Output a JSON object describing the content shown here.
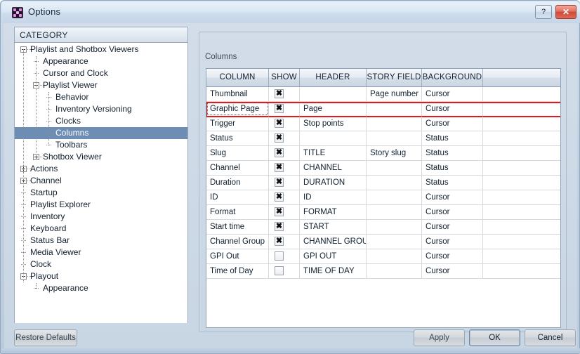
{
  "window": {
    "title": "Options",
    "app_icon": "options-app-icon",
    "help_button": "?",
    "close_button": "✕"
  },
  "category_panel": {
    "header": "CATEGORY",
    "items": [
      {
        "label": "Playlist and Shotbox Viewers",
        "depth": 0,
        "toggle": "minus",
        "selected": false
      },
      {
        "label": "Appearance",
        "depth": 1,
        "toggle": "none",
        "selected": false
      },
      {
        "label": "Cursor and Clock",
        "depth": 1,
        "toggle": "none",
        "selected": false
      },
      {
        "label": "Playlist Viewer",
        "depth": 1,
        "toggle": "minus",
        "selected": false
      },
      {
        "label": "Behavior",
        "depth": 2,
        "toggle": "none",
        "selected": false
      },
      {
        "label": "Inventory Versioning",
        "depth": 2,
        "toggle": "none",
        "selected": false
      },
      {
        "label": "Clocks",
        "depth": 2,
        "toggle": "none",
        "selected": false
      },
      {
        "label": "Columns",
        "depth": 2,
        "toggle": "none",
        "selected": true
      },
      {
        "label": "Toolbars",
        "depth": 2,
        "toggle": "none",
        "selected": false
      },
      {
        "label": "Shotbox Viewer",
        "depth": 1,
        "toggle": "plus",
        "selected": false
      },
      {
        "label": "Actions",
        "depth": 0,
        "toggle": "plus",
        "selected": false
      },
      {
        "label": "Channel",
        "depth": 0,
        "toggle": "plus",
        "selected": false
      },
      {
        "label": "Startup",
        "depth": 0,
        "toggle": "none",
        "selected": false
      },
      {
        "label": "Playlist Explorer",
        "depth": 0,
        "toggle": "none",
        "selected": false
      },
      {
        "label": "Inventory",
        "depth": 0,
        "toggle": "none",
        "selected": false
      },
      {
        "label": "Keyboard",
        "depth": 0,
        "toggle": "none",
        "selected": false
      },
      {
        "label": "Status Bar",
        "depth": 0,
        "toggle": "none",
        "selected": false
      },
      {
        "label": "Media Viewer",
        "depth": 0,
        "toggle": "none",
        "selected": false
      },
      {
        "label": "Clock",
        "depth": 0,
        "toggle": "none",
        "selected": false
      },
      {
        "label": "Playout",
        "depth": 0,
        "toggle": "minus",
        "selected": false
      },
      {
        "label": "Appearance",
        "depth": 1,
        "toggle": "none",
        "selected": false
      }
    ]
  },
  "groupbox": {
    "label": "Columns"
  },
  "grid": {
    "columns": [
      "COLUMN",
      "SHOW",
      "HEADER",
      "STORY FIELD",
      "BACKGROUND",
      ""
    ],
    "rows": [
      {
        "column": "Thumbnail",
        "show": true,
        "header": "",
        "story_field": "Page number",
        "background": "Cursor",
        "highlighted": false,
        "focused": false
      },
      {
        "column": "Graphic Page",
        "show": true,
        "header": "Page",
        "story_field": "",
        "background": "Cursor",
        "highlighted": true,
        "focused": true
      },
      {
        "column": "Trigger",
        "show": true,
        "header": "Stop points",
        "story_field": "",
        "background": "Cursor",
        "highlighted": false,
        "focused": false
      },
      {
        "column": "Status",
        "show": true,
        "header": "",
        "story_field": "",
        "background": "Status",
        "highlighted": false,
        "focused": false
      },
      {
        "column": "Slug",
        "show": true,
        "header": "TITLE",
        "story_field": "Story slug",
        "background": "Status",
        "highlighted": false,
        "focused": false
      },
      {
        "column": "Channel",
        "show": true,
        "header": "CHANNEL",
        "story_field": "",
        "background": "Status",
        "highlighted": false,
        "focused": false
      },
      {
        "column": "Duration",
        "show": true,
        "header": "DURATION",
        "story_field": "",
        "background": "Status",
        "highlighted": false,
        "focused": false
      },
      {
        "column": "ID",
        "show": true,
        "header": "ID",
        "story_field": "",
        "background": "Cursor",
        "highlighted": false,
        "focused": false
      },
      {
        "column": "Format",
        "show": true,
        "header": "FORMAT",
        "story_field": "",
        "background": "Cursor",
        "highlighted": false,
        "focused": false
      },
      {
        "column": "Start time",
        "show": true,
        "header": "START",
        "story_field": "",
        "background": "Cursor",
        "highlighted": false,
        "focused": false
      },
      {
        "column": "Channel Group",
        "show": true,
        "header": "CHANNEL GROUP",
        "story_field": "",
        "background": "Cursor",
        "highlighted": false,
        "focused": false
      },
      {
        "column": "GPI Out",
        "show": false,
        "header": "GPI OUT",
        "story_field": "",
        "background": "Cursor",
        "highlighted": false,
        "focused": false
      },
      {
        "column": "Time of Day",
        "show": false,
        "header": "TIME OF DAY",
        "story_field": "",
        "background": "Cursor",
        "highlighted": false,
        "focused": false
      }
    ],
    "highlight_color": "#e01b1b"
  },
  "footer": {
    "restore_defaults": "Restore Defaults",
    "apply": "Apply",
    "ok": "OK",
    "cancel": "Cancel"
  },
  "colors": {
    "selection": "#6d8db5",
    "close_button": "#cf4a37",
    "highlight": "#e01b1b"
  }
}
